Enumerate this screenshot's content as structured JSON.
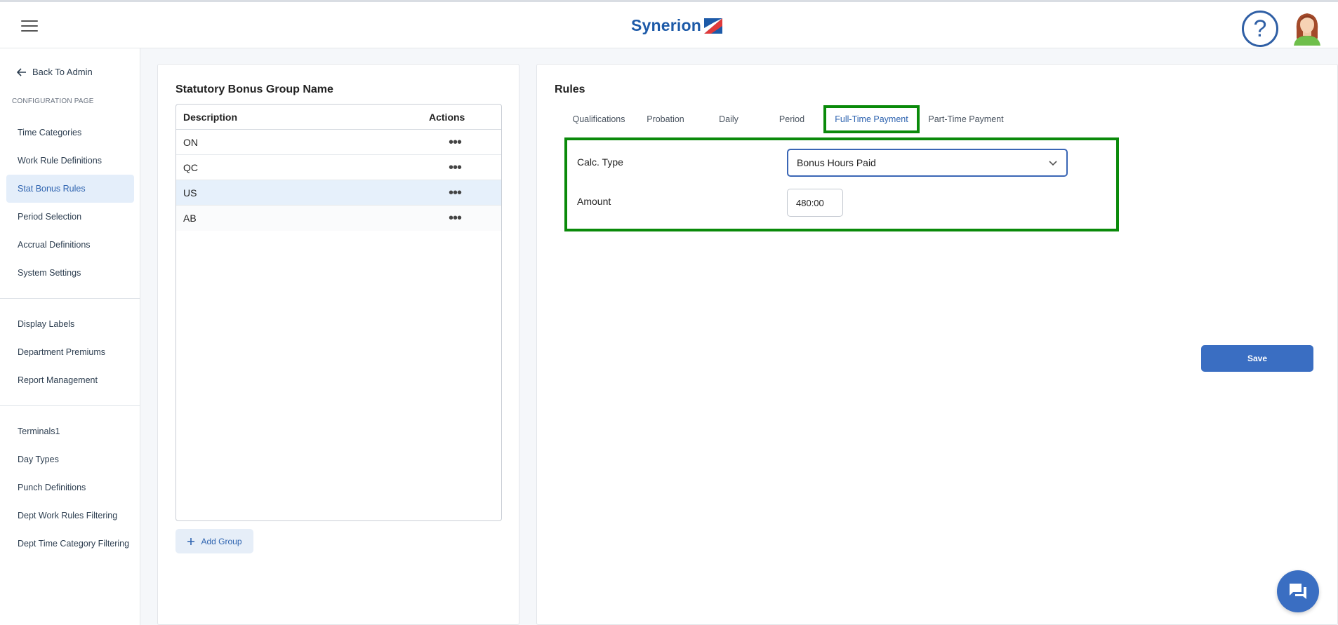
{
  "header": {
    "logo_text": "Synerion",
    "help_label": "?"
  },
  "sidebar": {
    "back_label": "Back To Admin",
    "section_label": "CONFIGURATION PAGE",
    "group1": [
      {
        "label": "Time Categories"
      },
      {
        "label": "Work Rule Definitions"
      },
      {
        "label": "Stat Bonus Rules",
        "active": true
      },
      {
        "label": "Period Selection"
      },
      {
        "label": "Accrual Definitions"
      },
      {
        "label": "System Settings"
      }
    ],
    "group2": [
      {
        "label": "Display Labels"
      },
      {
        "label": "Department Premiums"
      },
      {
        "label": "Report Management"
      }
    ],
    "group3": [
      {
        "label": "Terminals1"
      },
      {
        "label": "Day Types"
      },
      {
        "label": "Punch Definitions"
      },
      {
        "label": "Dept Work Rules Filtering"
      },
      {
        "label": "Dept Time Category Filtering"
      }
    ]
  },
  "groups_panel": {
    "title": "Statutory Bonus Group Name",
    "columns": [
      "Description",
      "Actions"
    ],
    "rows": [
      {
        "description": "ON",
        "actions": "•••"
      },
      {
        "description": "QC",
        "actions": "•••"
      },
      {
        "description": "US",
        "actions": "•••",
        "selected": true
      },
      {
        "description": "AB",
        "actions": "•••"
      }
    ],
    "add_label": "Add Group"
  },
  "rules_panel": {
    "title": "Rules",
    "tabs": [
      "Qualifications",
      "Probation",
      "Daily",
      "Period",
      "Full-Time Payment",
      "Part-Time Payment"
    ],
    "active_tab": "Full-Time Payment",
    "calc_type_label": "Calc. Type",
    "calc_type_value": "Bonus Hours Paid",
    "amount_label": "Amount",
    "amount_value": "480:00",
    "save_label": "Save"
  },
  "colors": {
    "accent": "#3a6ec2",
    "highlight": "#0a8a0a",
    "active_nav_bg": "#e4eefa"
  }
}
